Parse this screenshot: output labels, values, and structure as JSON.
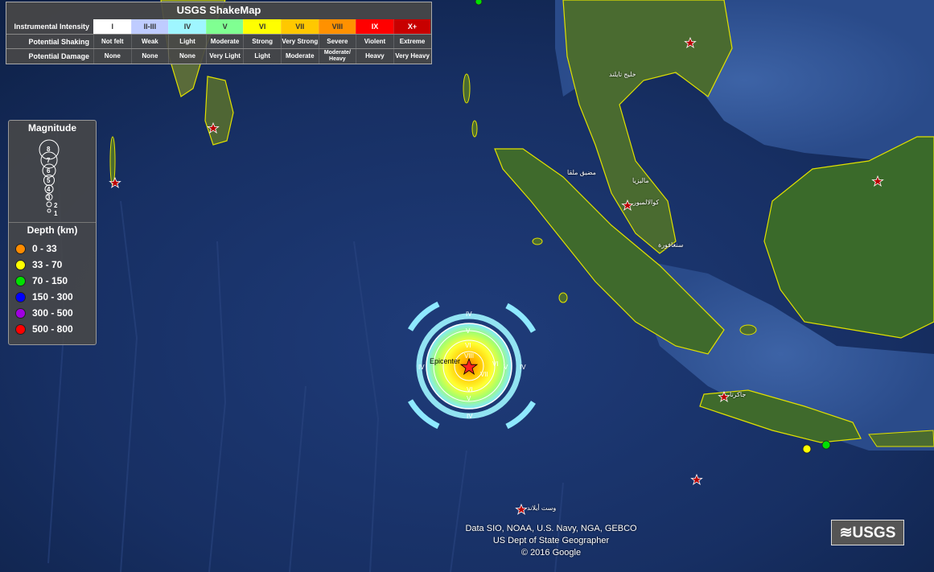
{
  "intensity_table": {
    "title": "USGS ShakeMap",
    "row_labels": {
      "instrumental": "Instrumental Intensity",
      "shaking": "Potential Shaking",
      "damage": "Potential Damage"
    },
    "levels": [
      {
        "intensity": "I",
        "shaking": "Not felt",
        "damage": "None",
        "color": "#ffffff"
      },
      {
        "intensity": "II-III",
        "shaking": "Weak",
        "damage": "None",
        "color": "#bfccff"
      },
      {
        "intensity": "IV",
        "shaking": "Light",
        "damage": "None",
        "color": "#9ff6ff"
      },
      {
        "intensity": "V",
        "shaking": "Moderate",
        "damage": "Very Light",
        "color": "#80ff92"
      },
      {
        "intensity": "VI",
        "shaking": "Strong",
        "damage": "Light",
        "color": "#ffff00"
      },
      {
        "intensity": "VII",
        "shaking": "Very Strong",
        "damage": "Moderate",
        "color": "#ffc800"
      },
      {
        "intensity": "VIII",
        "shaking": "Severe",
        "damage": "Moderate/ Heavy",
        "color": "#ff9100"
      },
      {
        "intensity": "IX",
        "shaking": "Violent",
        "damage": "Heavy",
        "color": "#ff0000"
      },
      {
        "intensity": "X+",
        "shaking": "Extreme",
        "damage": "Very Heavy",
        "color": "#c80000"
      }
    ]
  },
  "magnitude_legend": {
    "title": "Magnitude",
    "values": [
      "8",
      "7",
      "6",
      "5",
      "4",
      "3",
      "2",
      "1"
    ]
  },
  "depth_legend": {
    "title": "Depth (km)",
    "items": [
      {
        "label": "0 - 33",
        "color": "#ff8c00"
      },
      {
        "label": "33 - 70",
        "color": "#ffff00"
      },
      {
        "label": "70 - 150",
        "color": "#00e000"
      },
      {
        "label": "150 - 300",
        "color": "#0000ff"
      },
      {
        "label": "300 - 500",
        "color": "#a000e0"
      },
      {
        "label": "500 - 800",
        "color": "#ff0000"
      }
    ]
  },
  "epicenter": {
    "label": "Epicenter",
    "contour_labels": [
      "VIII",
      "VII",
      "VI",
      "V",
      "IV"
    ]
  },
  "place_labels": {
    "gulf": "خليج تايلند",
    "strait": "مضيق ملقا",
    "malaysia": "ماليزيا",
    "kl": "كوالالمبور",
    "singapore": "سنغافورة",
    "jakarta": "جاكرتا",
    "christmas": "وست أيلاند"
  },
  "attribution": {
    "line1": "Data SIO, NOAA, U.S. Navy, NGA, GEBCO",
    "line2": "US Dept of State Geographer",
    "line3": "© 2016 Google"
  },
  "logo": "≋USGS"
}
